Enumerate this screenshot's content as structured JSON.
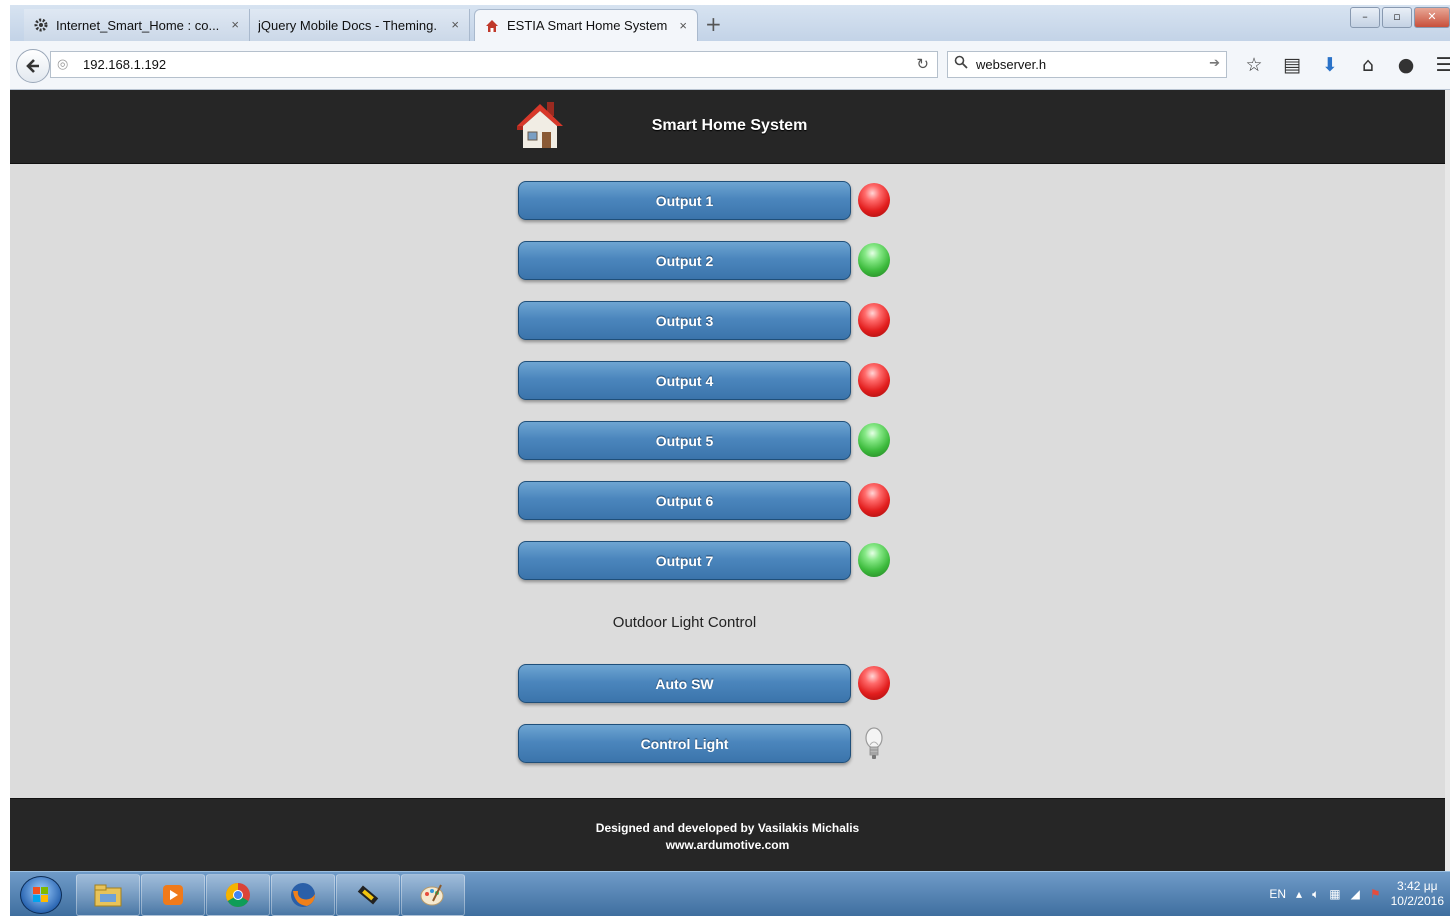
{
  "browser": {
    "tabs": [
      {
        "label": "Internet_Smart_Home : co...",
        "icon": "gear-icon",
        "active": false
      },
      {
        "label": "jQuery Mobile Docs - Theming...",
        "icon": "none",
        "active": false
      },
      {
        "label": "ESTIA Smart Home System",
        "icon": "house-favicon",
        "active": true
      }
    ],
    "close_glyph": "×",
    "new_tab_glyph": "+",
    "url": "192.168.1.192",
    "search_value": "webserver.h"
  },
  "app": {
    "title": "Smart Home System",
    "outputs": [
      {
        "label": "Output 1",
        "state": "red"
      },
      {
        "label": "Output 2",
        "state": "green"
      },
      {
        "label": "Output 3",
        "state": "red"
      },
      {
        "label": "Output 4",
        "state": "red"
      },
      {
        "label": "Output 5",
        "state": "green"
      },
      {
        "label": "Output 6",
        "state": "red"
      },
      {
        "label": "Output 7",
        "state": "green"
      }
    ],
    "section_label": "Outdoor Light Control",
    "auto_sw": {
      "label": "Auto SW",
      "state": "red"
    },
    "control_light": {
      "label": "Control Light",
      "indicator": "bulb-off"
    },
    "footer": {
      "line1": "Designed and developed by Vasilakis Michalis",
      "line2": "www.ardumotive.com"
    }
  },
  "taskbar": {
    "language": "EN",
    "time": "3:42 μμ",
    "date": "10/2/2016",
    "apps": [
      "explorer-icon",
      "media-player-icon",
      "chrome-icon",
      "firefox-icon",
      "arduino-tool-icon",
      "paint-icon"
    ]
  }
}
